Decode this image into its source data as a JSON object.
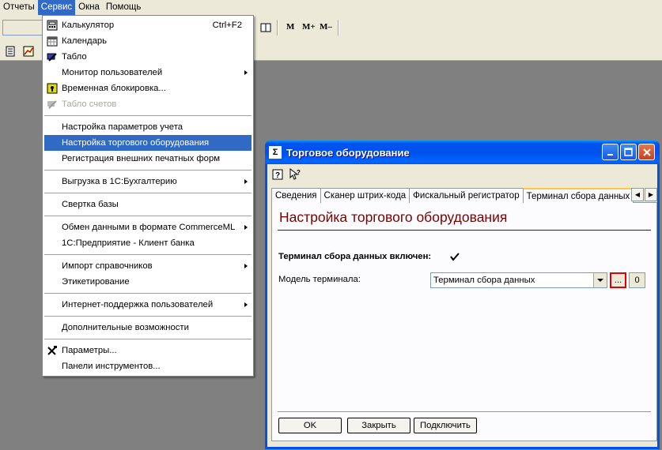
{
  "menubar": {
    "items": [
      "Отчеты",
      "Сервис",
      "Окна",
      "Помощь"
    ]
  },
  "toolbar": {
    "m_label": "M",
    "m_plus_label": "M+",
    "m_minus_label": "M–"
  },
  "menu": {
    "items": [
      {
        "label": "Калькулятор",
        "accel": "Ctrl+F2",
        "icon": "calculator-icon"
      },
      {
        "label": "Календарь",
        "icon": "calendar-icon"
      },
      {
        "label": "Табло",
        "icon": "scoreboard-icon"
      },
      {
        "label": "Монитор пользователей"
      },
      {
        "label": "Временная блокировка...",
        "icon": "lock-icon"
      },
      {
        "label": "Табло счетов",
        "icon": "accounts-board-icon",
        "disabled": true
      },
      {
        "label": "Настройка параметров учета"
      },
      {
        "label": "Настройка торгового оборудования",
        "highlighted": true
      },
      {
        "label": "Регистрация внешних печатных форм"
      },
      {
        "label": "Выгрузка в 1С:Бухгалтерию"
      },
      {
        "label": "Свертка базы"
      },
      {
        "label": "Обмен данными в формате CommerceML"
      },
      {
        "label": "1С:Предприятие - Клиент банка"
      },
      {
        "label": "Импорт справочников"
      },
      {
        "label": "Этикетирование"
      },
      {
        "label": "Интернет-поддержка пользователей"
      },
      {
        "label": "Дополнительные возможности"
      },
      {
        "label": "Параметры...",
        "icon": "tools-icon"
      },
      {
        "label": "Панели инструментов..."
      }
    ]
  },
  "dialog": {
    "title": "Торговое оборудование",
    "tabs": [
      "Сведения",
      "Сканер штрих-кода",
      "Фискальный регистратор",
      "Терминал сбора данных"
    ],
    "heading": "Настройка торгового оборудования",
    "enabled_label": "Терминал сбора данных включен:",
    "enabled_checked": true,
    "model_label": "Модель терминала:",
    "model_value": "Терминал сбора данных",
    "select_button": "...",
    "clear_button": "0",
    "ok_button": "OK",
    "close_button": "Закрыть",
    "connect_button": "Подключить"
  },
  "colors": {
    "highlight": "#316ac5",
    "heading": "#7a0000",
    "titlebar": "#0054e3",
    "focus_outline": "#e00000"
  }
}
